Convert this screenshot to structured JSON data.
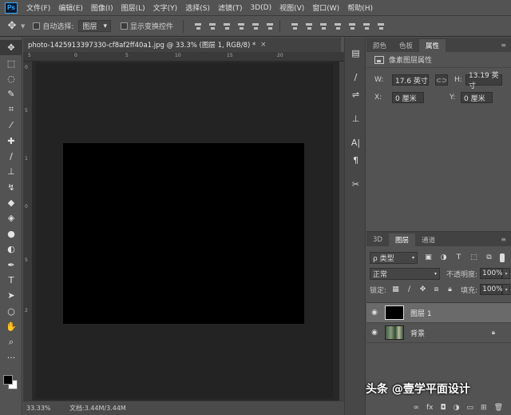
{
  "app": {
    "logo": "Ps"
  },
  "menu": [
    "文件(F)",
    "编辑(E)",
    "图像(I)",
    "图层(L)",
    "文字(Y)",
    "选择(S)",
    "滤镜(T)",
    "3D(D)",
    "视图(V)",
    "窗口(W)",
    "帮助(H)"
  ],
  "options": {
    "auto_select_label": "自动选择:",
    "auto_select_value": "图层",
    "show_transform_label": "显示变换控件"
  },
  "document": {
    "tab_title": "photo-1425913397330-cf8af2ff40a1.jpg @ 33.3% (图层 1, RGB/8) *",
    "close": "×",
    "ruler_top": [
      "5",
      "0",
      "5",
      "10",
      "15",
      "20"
    ],
    "ruler_left": [
      "0",
      "5",
      "1",
      "0",
      "5",
      "2"
    ],
    "status_zoom": "33.33%",
    "status_doc": "文档:3.44M/3.44M"
  },
  "properties_panel": {
    "tabs": [
      "颜色",
      "色板",
      "属性"
    ],
    "active_tab": "属性",
    "header": "像素图层属性",
    "w_label": "W:",
    "w_value": "17.6 英寸",
    "h_label": "H:",
    "h_value": "13.19 英寸",
    "x_label": "X:",
    "x_value": "0 厘米",
    "y_label": "Y:",
    "y_value": "0 厘米",
    "link_icon": "link-icon"
  },
  "layers_panel": {
    "tabs": [
      "3D",
      "图层",
      "通道"
    ],
    "active_tab": "图层",
    "kind_filter": "ρ 类型",
    "blend_mode": "正常",
    "opacity_label": "不透明度:",
    "opacity_value": "100%",
    "lock_label": "锁定:",
    "fill_label": "填充:",
    "fill_value": "100%",
    "layers": [
      {
        "name": "图层 1",
        "selected": true,
        "thumb": "black"
      },
      {
        "name": "背景",
        "selected": false,
        "thumb": "photo",
        "locked": true
      }
    ]
  },
  "watermark": "头条 @壹学平面设计",
  "colors": {
    "foreground": "#000000",
    "background": "#ffffff"
  }
}
